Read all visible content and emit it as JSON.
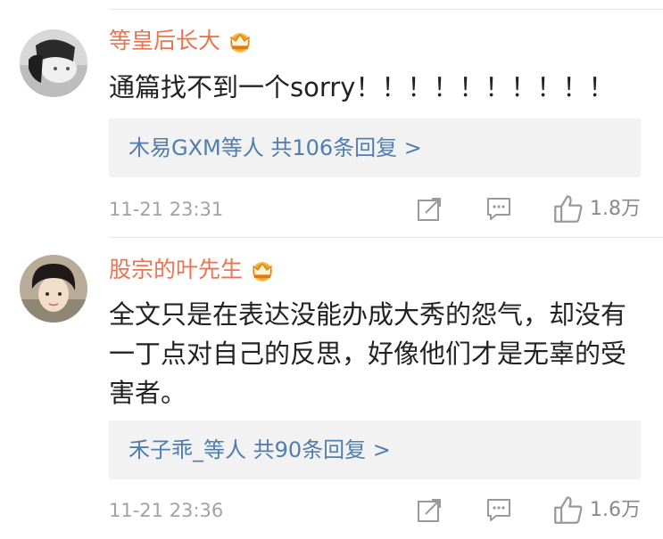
{
  "comments": [
    {
      "username": "等皇后长大",
      "text": "通篇找不到一个sorry！！！！！！！！！！",
      "reply_link": "木易GXM等人  共106条回复 >",
      "timestamp": "11-21 23:31",
      "likes": "1.8万"
    },
    {
      "username": "股宗的叶先生",
      "text": "全文只是在表达没能办成大秀的怨气，却没有一丁点对自己的反思，好像他们才是无辜的受害者。",
      "reply_link": "禾子乖_等人  共90条回复 >",
      "timestamp": "11-21 23:36",
      "likes": "1.6万"
    }
  ],
  "colors": {
    "username": "#eb7350",
    "reply_link": "#507daf",
    "text": "#222222",
    "meta": "#a3a3a3",
    "reply_bg": "#f2f2f2",
    "crown": "#f0a020"
  },
  "icons": [
    "crown-icon",
    "share-icon",
    "comment-icon",
    "like-icon"
  ]
}
